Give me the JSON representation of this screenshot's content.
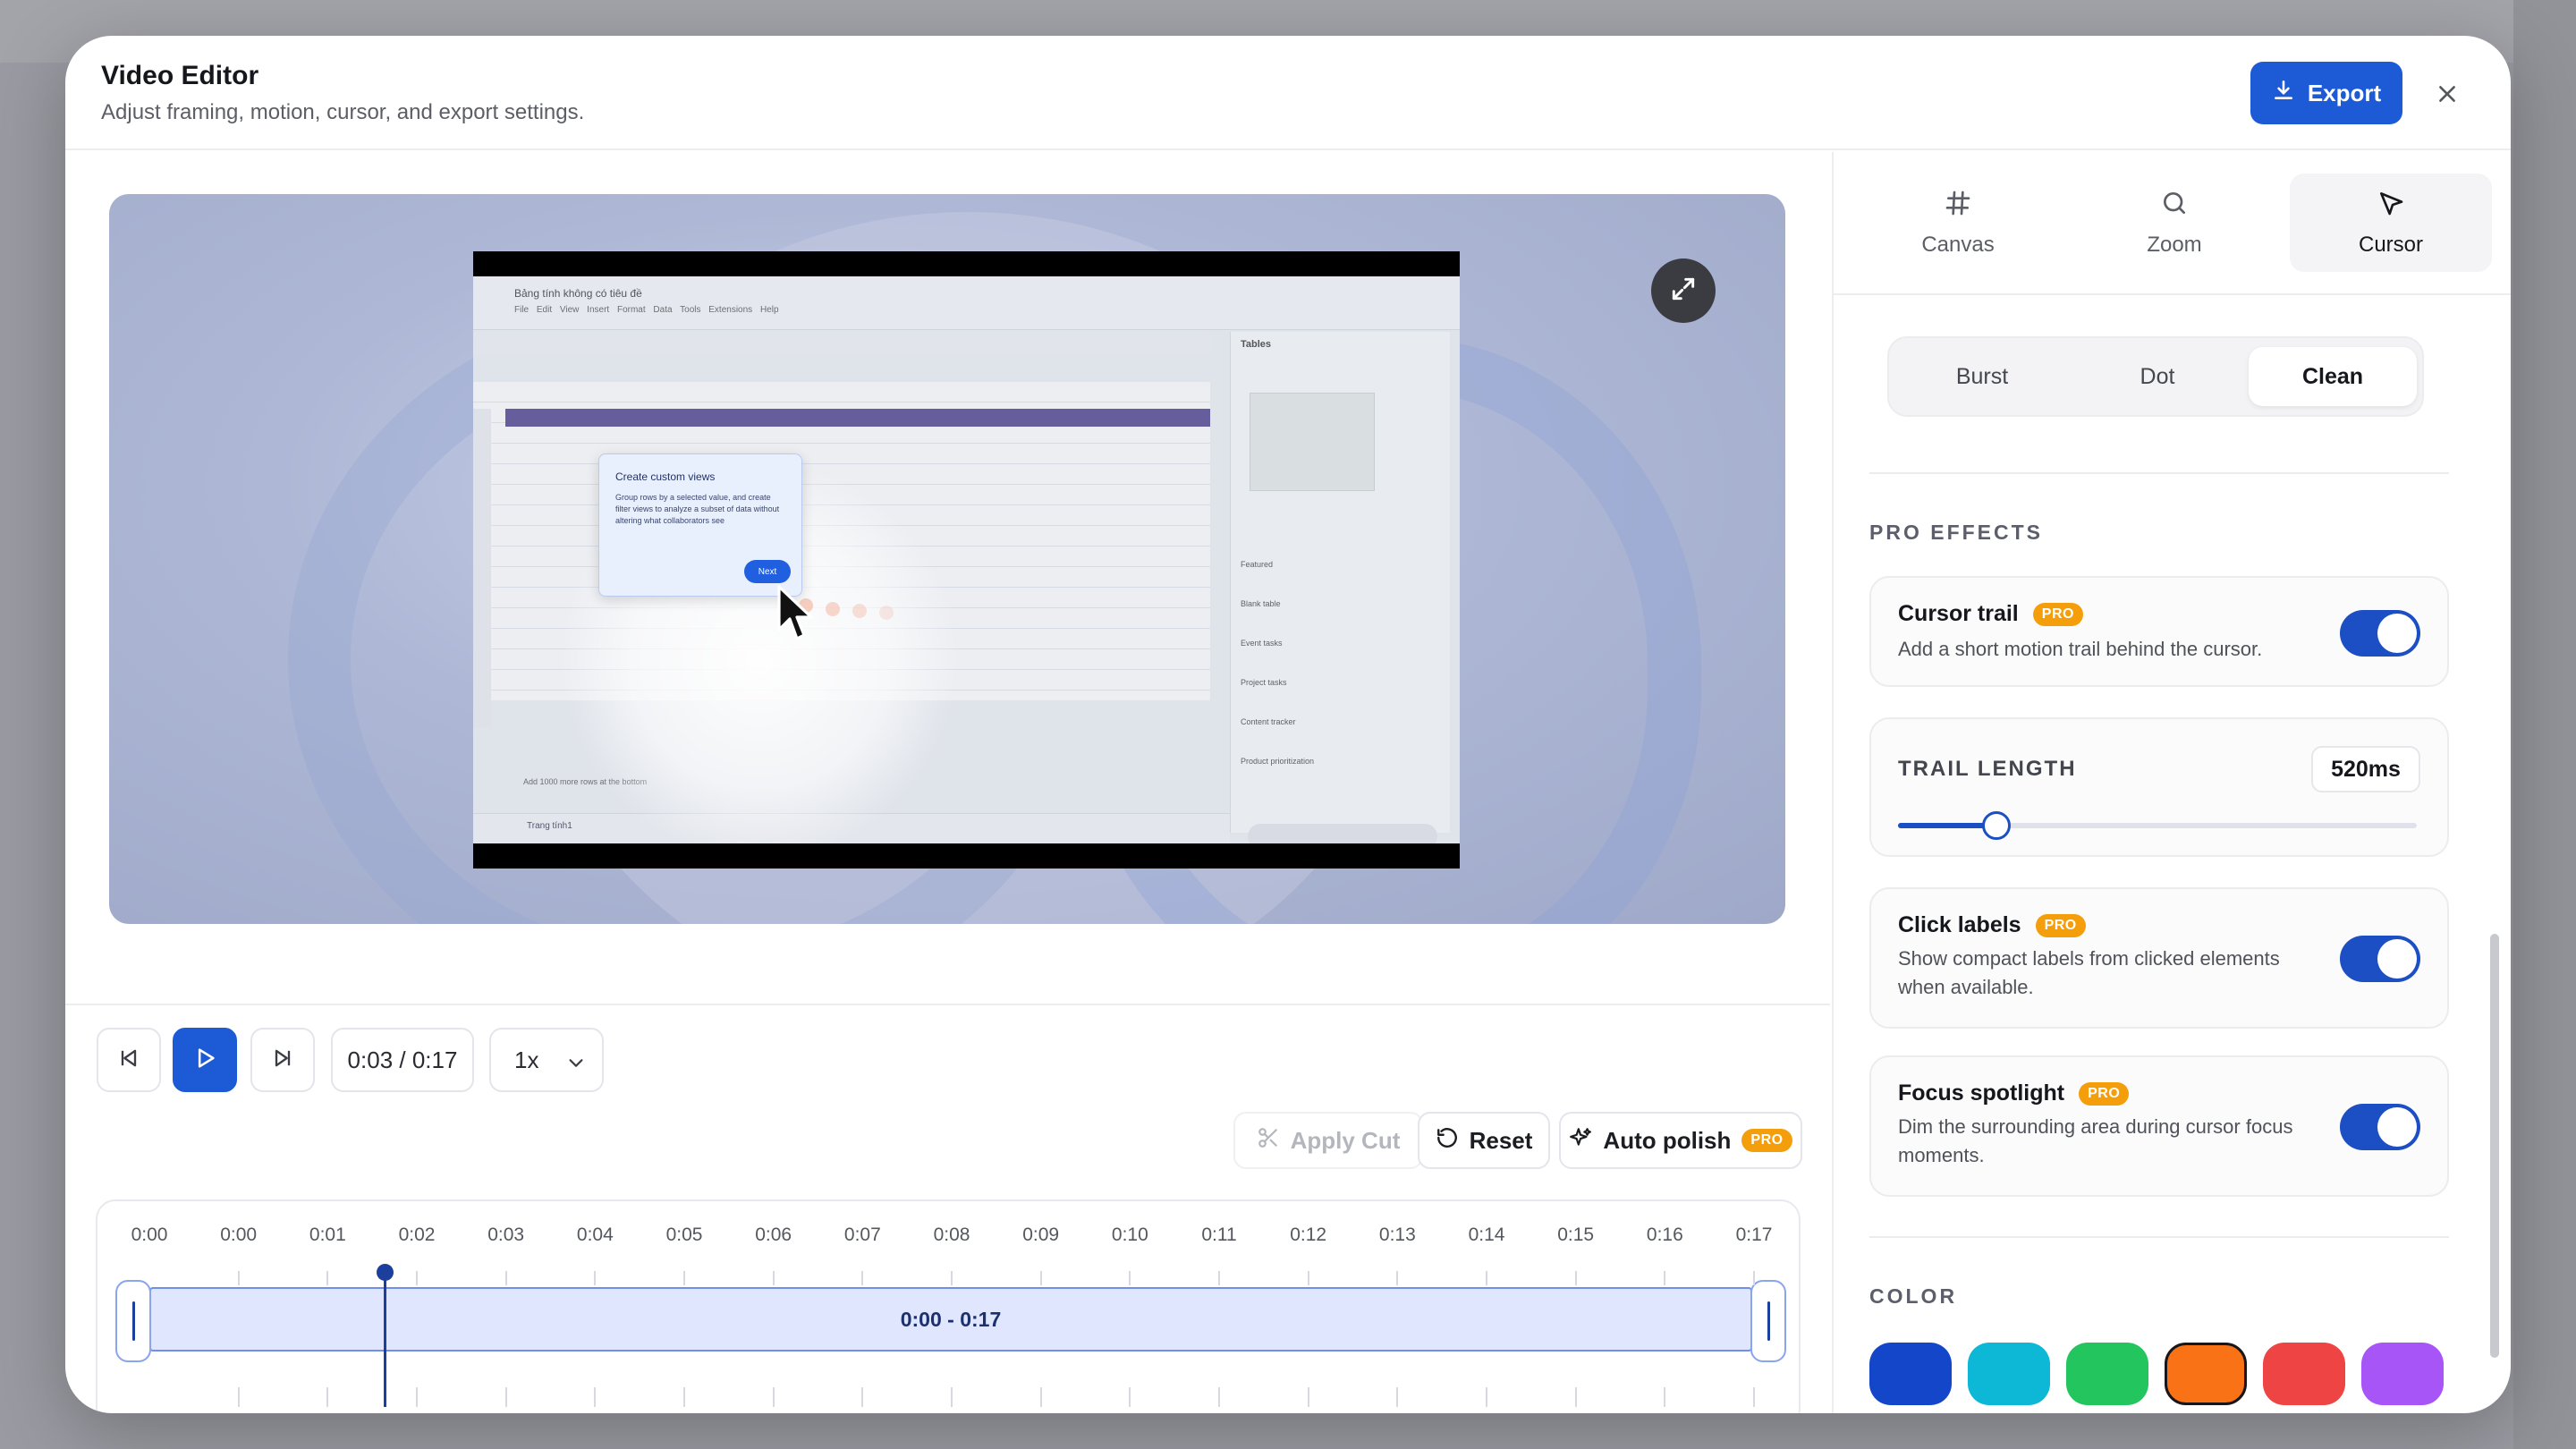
{
  "header": {
    "title": "Video Editor",
    "subtitle": "Adjust framing, motion, cursor, and export settings.",
    "export_label": "Export"
  },
  "preview": {
    "spreadsheet_title": "Bảng tính không có tiêu đề",
    "menu": "File Edit View Insert Format Data Tools Extensions Help",
    "side_title": "Tables",
    "side_items": [
      "Featured",
      "Blank table",
      "Event tasks",
      "Project tasks",
      "Content tracker",
      "Product prioritization"
    ],
    "popup_title": "Create custom views",
    "popup_text": "Group rows by a selected value, and create filter views to analyze a subset of data without altering what collaborators see",
    "popup_next": "Next",
    "sheet_tab": "Trang tính1",
    "add_rows": "Add 1000 more rows at the bottom"
  },
  "controls": {
    "time": "0:03 / 0:17",
    "speed": "1x",
    "apply_cut": "Apply Cut",
    "reset": "Reset",
    "auto_polish": "Auto polish",
    "pro": "PRO"
  },
  "timeline": {
    "ticks": [
      "0:00",
      "0:00",
      "0:01",
      "0:02",
      "0:03",
      "0:04",
      "0:05",
      "0:06",
      "0:07",
      "0:08",
      "0:09",
      "0:10",
      "0:11",
      "0:12",
      "0:13",
      "0:14",
      "0:15",
      "0:16",
      "0:17"
    ],
    "range_label": "0:00 - 0:17",
    "playhead_time": "0:02"
  },
  "panel": {
    "tabs": [
      {
        "label": "Canvas",
        "icon": "hash-icon"
      },
      {
        "label": "Zoom",
        "icon": "search-icon"
      },
      {
        "label": "Cursor",
        "icon": "pointer-icon"
      }
    ],
    "active_tab": "Cursor",
    "styles": [
      "Burst",
      "Dot",
      "Clean"
    ],
    "active_style": "Clean",
    "pro_effects_label": "PRO EFFECTS",
    "cursor_trail": {
      "title": "Cursor trail",
      "desc": "Add a short motion trail behind the cursor.",
      "enabled": true
    },
    "trail_length": {
      "label": "TRAIL LENGTH",
      "value": "520ms",
      "slider_fraction": 0.19
    },
    "click_labels": {
      "title": "Click labels",
      "desc": "Show compact labels from clicked elements when available.",
      "enabled": true
    },
    "focus_spotlight": {
      "title": "Focus spotlight",
      "desc": "Dim the surrounding area during cursor focus moments.",
      "enabled": true
    },
    "color_label": "COLOR",
    "colors": [
      "#1346c8",
      "#0cb8d6",
      "#22c55e",
      "#f97316",
      "#ef4444",
      "#a855f7"
    ],
    "selected_color": "#f97316"
  }
}
